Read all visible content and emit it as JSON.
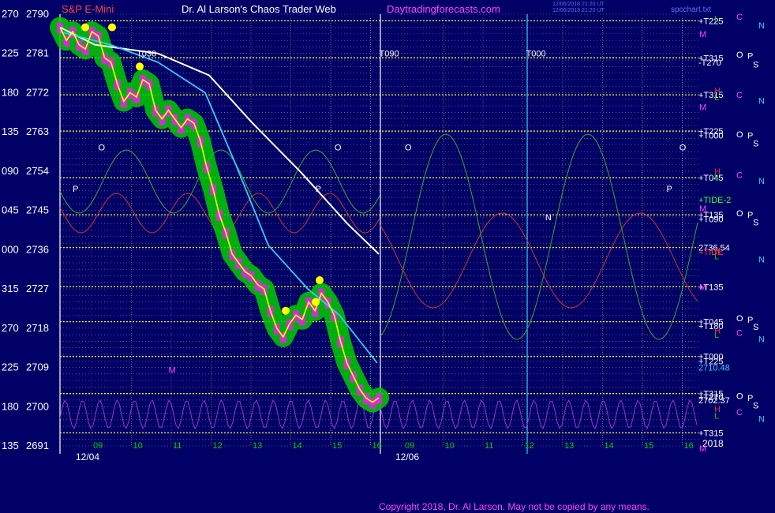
{
  "header": {
    "instrument": "S&P E-Mini",
    "title": "Dr. Al Larson's Chaos Trader Web",
    "site": "Daytradingforecasts.com",
    "timestamp_line1": "12/06/2018 21:20 UT",
    "timestamp_line2": "12/06/2018 21:20 UT",
    "file": "spcchart.txt"
  },
  "footer": {
    "copyright": "Copyright 2018, Dr. Al Larson. May not be copied by any means."
  },
  "colors": {
    "background": "#000066",
    "grid_dotted": "#cccc66",
    "price_line": "#ffff00",
    "cloud": "#00cc00",
    "magenta_bars": "#cc33cc",
    "white_ma": "#ffffff",
    "cyan_ma": "#33ccff",
    "red_wave": "#cc3333",
    "green_wave": "#33aa33",
    "purple_wave": "#9933cc",
    "orange_label": "#ff6600",
    "yellow_label": "#ffff00",
    "magenta_label": "#ff44ff",
    "white_label": "#ffffff",
    "cyan_label": "#33ccff"
  },
  "chart_data": {
    "type": "line",
    "title": "S&P E-Mini",
    "y_axis_left": {
      "labels": [
        {
          "angle": "270",
          "price": "2790"
        },
        {
          "angle": "225",
          "price": "2781"
        },
        {
          "angle": "180",
          "price": "2772"
        },
        {
          "angle": "135",
          "price": "2763"
        },
        {
          "angle": "090",
          "price": "2754"
        },
        {
          "angle": "045",
          "price": "2745"
        },
        {
          "angle": "000",
          "price": "2736"
        },
        {
          "angle": "315",
          "price": "2727"
        },
        {
          "angle": "270",
          "price": "2718"
        },
        {
          "angle": "225",
          "price": "2709"
        },
        {
          "angle": "180",
          "price": "2700"
        },
        {
          "angle": "135",
          "price": "2691"
        }
      ],
      "ylim": [
        2691,
        2790
      ]
    },
    "x_axis": {
      "hour_ticks_day1": [
        "09",
        "10",
        "11",
        "12",
        "13",
        "14",
        "15",
        "16"
      ],
      "hour_ticks_day2": [
        "09",
        "10",
        "11",
        "12",
        "13",
        "14",
        "15",
        "16"
      ],
      "date_labels": [
        "12/04",
        "12/06"
      ],
      "end_label": "2018"
    },
    "price_series": {
      "name": "",
      "x": [
        0,
        0.02,
        0.04,
        0.06,
        0.08,
        0.1,
        0.12,
        0.14,
        0.16,
        0.18,
        0.2,
        0.22,
        0.24,
        0.26,
        0.28,
        0.3,
        0.32,
        0.34,
        0.36,
        0.38,
        0.4,
        0.42,
        0.44,
        0.46,
        0.48,
        0.5,
        0.52,
        0.54,
        0.56,
        0.58,
        0.6,
        0.62,
        0.64,
        0.66,
        0.68,
        0.7,
        0.72,
        0.74,
        0.76,
        0.78,
        0.8,
        0.82,
        0.84,
        0.86,
        0.88,
        0.9,
        0.92,
        0.94,
        0.96,
        0.98,
        1.0
      ],
      "values": [
        2787,
        2784,
        2786,
        2783,
        2782,
        2786,
        2785,
        2780,
        2779,
        2774,
        2770,
        2772,
        2771,
        2775,
        2774,
        2768,
        2766,
        2768,
        2766,
        2764,
        2766,
        2765,
        2761,
        2755,
        2750,
        2744,
        2740,
        2735,
        2733,
        2731,
        2730,
        2728,
        2727,
        2722,
        2718,
        2716,
        2719,
        2721,
        2720,
        2724,
        2722,
        2726,
        2724,
        2721,
        2715,
        2710,
        2707,
        2704,
        2702,
        2701,
        2702
      ]
    },
    "right_labels": [
      {
        "text": "+T225",
        "price": 2788.5,
        "color": "#ffffff"
      },
      {
        "text": "+T315",
        "price": 2780,
        "color": "#ffffff"
      },
      {
        "text": "-T270",
        "price": 2779,
        "color": "#ffffff"
      },
      {
        "text": "+T315",
        "price": 2771.5,
        "color": "#ffffff"
      },
      {
        "text": "+T225",
        "price": 2763.2,
        "color": "#ffffff"
      },
      {
        "text": "+T000",
        "price": 2762.2,
        "color": "#ffffff"
      },
      {
        "text": "+T045",
        "price": 2752.5,
        "color": "#ffffff"
      },
      {
        "text": "+TIDE-2",
        "price": 2747.5,
        "color": "#33ff33"
      },
      {
        "text": "+T135",
        "price": 2744,
        "color": "#ffffff"
      },
      {
        "text": "+T090",
        "price": 2743,
        "color": "#ffffff"
      },
      {
        "text": "2736.54",
        "price": 2736.5,
        "color": "#ffffff"
      },
      {
        "text": "+TIDE",
        "price": 2735.5,
        "color": "#ff3333"
      },
      {
        "text": "+T135",
        "price": 2727.5,
        "color": "#ffffff"
      },
      {
        "text": "+T045",
        "price": 2719.5,
        "color": "#ffffff"
      },
      {
        "text": "+T180",
        "price": 2718.5,
        "color": "#ffffff"
      },
      {
        "text": "+T000",
        "price": 2711.5,
        "color": "#ffffff"
      },
      {
        "text": "+T225",
        "price": 2710.5,
        "color": "#ffffff"
      },
      {
        "text": "2710.48",
        "price": 2709,
        "color": "#33ccff"
      },
      {
        "text": "+T315",
        "price": 2703,
        "color": "#ffffff"
      },
      {
        "text": "+T270",
        "price": 2702.2,
        "color": "#ffffff"
      },
      {
        "text": "2702.37",
        "price": 2701.5,
        "color": "#ffffff"
      },
      {
        "text": "+T315",
        "price": 2694,
        "color": "#ffffff"
      }
    ],
    "side_letters": [
      {
        "text": "C",
        "price": 2789.5,
        "col": 0,
        "color": "#ff44ff"
      },
      {
        "text": "N",
        "price": 2787.5,
        "col": 1,
        "color": "#33ccff"
      },
      {
        "text": "M",
        "price": 2785.5,
        "col": 2,
        "color": "#ff44ff"
      },
      {
        "text": "O",
        "price": 2780.8,
        "col": 3,
        "color": "#ffffff"
      },
      {
        "text": "P",
        "price": 2780.5,
        "col": 4,
        "color": "#ffffff"
      },
      {
        "text": "S",
        "price": 2778.5,
        "col": 5,
        "color": "#ffffff"
      },
      {
        "text": "C",
        "price": 2771.5,
        "col": 0,
        "color": "#ff44ff"
      },
      {
        "text": "N",
        "price": 2770.2,
        "col": 1,
        "color": "#33ccff"
      },
      {
        "text": "M",
        "price": 2768.7,
        "col": 2,
        "color": "#ff44ff"
      },
      {
        "text": "O",
        "price": 2762.5,
        "col": 3,
        "color": "#ffffff"
      },
      {
        "text": "P",
        "price": 2762.2,
        "col": 4,
        "color": "#ffffff"
      },
      {
        "text": "S",
        "price": 2760.4,
        "col": 5,
        "color": "#ffffff"
      },
      {
        "text": "C",
        "price": 2753.2,
        "col": 0,
        "color": "#ff44ff"
      },
      {
        "text": "N",
        "price": 2751.8,
        "col": 1,
        "color": "#33ccff"
      },
      {
        "text": "M",
        "price": 2745.5,
        "col": 2,
        "color": "#ff44ff"
      },
      {
        "text": "O",
        "price": 2744.4,
        "col": 3,
        "color": "#ffffff"
      },
      {
        "text": "P",
        "price": 2744,
        "col": 4,
        "color": "#ffffff"
      },
      {
        "text": "S",
        "price": 2742.3,
        "col": 5,
        "color": "#ffffff"
      },
      {
        "text": "N",
        "price": 2733.8,
        "col": 1,
        "color": "#33ccff"
      },
      {
        "text": "M",
        "price": 2727.5,
        "col": 2,
        "color": "#ff44ff"
      },
      {
        "text": "O",
        "price": 2720.3,
        "col": 3,
        "color": "#ffffff"
      },
      {
        "text": "P",
        "price": 2720,
        "col": 4,
        "color": "#ffffff"
      },
      {
        "text": "S",
        "price": 2718.3,
        "col": 5,
        "color": "#ffffff"
      },
      {
        "text": "C",
        "price": 2717,
        "col": 0,
        "color": "#ff44ff"
      },
      {
        "text": "N",
        "price": 2715.5,
        "col": 1,
        "color": "#33ccff"
      },
      {
        "text": "O",
        "price": 2702.5,
        "col": 3,
        "color": "#ffffff"
      },
      {
        "text": "P",
        "price": 2702,
        "col": 4,
        "color": "#ffffff"
      },
      {
        "text": "S",
        "price": 2700.3,
        "col": 5,
        "color": "#ffffff"
      },
      {
        "text": "C",
        "price": 2698.8,
        "col": 0,
        "color": "#ff44ff"
      },
      {
        "text": "N",
        "price": 2697.2,
        "col": 1,
        "color": "#33ccff"
      },
      {
        "text": "M",
        "price": 2690.5,
        "col": 2,
        "color": "#ff44ff"
      }
    ],
    "grid_letters_right": [
      {
        "text": "L",
        "price": 2789
      },
      {
        "text": "H",
        "price": 2772.5
      },
      {
        "text": "L",
        "price": 2771
      },
      {
        "text": "H",
        "price": 2754
      },
      {
        "text": "L",
        "price": 2752.8
      },
      {
        "text": "H",
        "price": 2735.8
      },
      {
        "text": "L",
        "price": 2734.5
      },
      {
        "text": "H",
        "price": 2717.5
      },
      {
        "text": "L",
        "price": 2716.5
      },
      {
        "text": "H",
        "price": 2699.5
      },
      {
        "text": "L",
        "price": 2698
      }
    ],
    "in_chart_labels": [
      {
        "text": "T030",
        "x": 0.12,
        "price": 2781
      },
      {
        "text": "T090",
        "x": 0.5,
        "price": 2781
      },
      {
        "text": "T000",
        "x": 0.73,
        "price": 2781
      },
      {
        "text": "O",
        "x": 0.06,
        "price": 2759.5
      },
      {
        "text": "O",
        "x": 0.43,
        "price": 2759.5
      },
      {
        "text": "O",
        "x": 0.54,
        "price": 2759.5
      },
      {
        "text": "O",
        "x": 0.97,
        "price": 2759.5
      },
      {
        "text": "P",
        "x": 0.02,
        "price": 2750
      },
      {
        "text": "P",
        "x": 0.4,
        "price": 2750
      },
      {
        "text": "P",
        "x": 0.95,
        "price": 2750
      },
      {
        "text": "N",
        "x": 0.76,
        "price": 2743.5
      },
      {
        "text": "M",
        "x": 0.17,
        "price": 2708.5
      }
    ]
  }
}
